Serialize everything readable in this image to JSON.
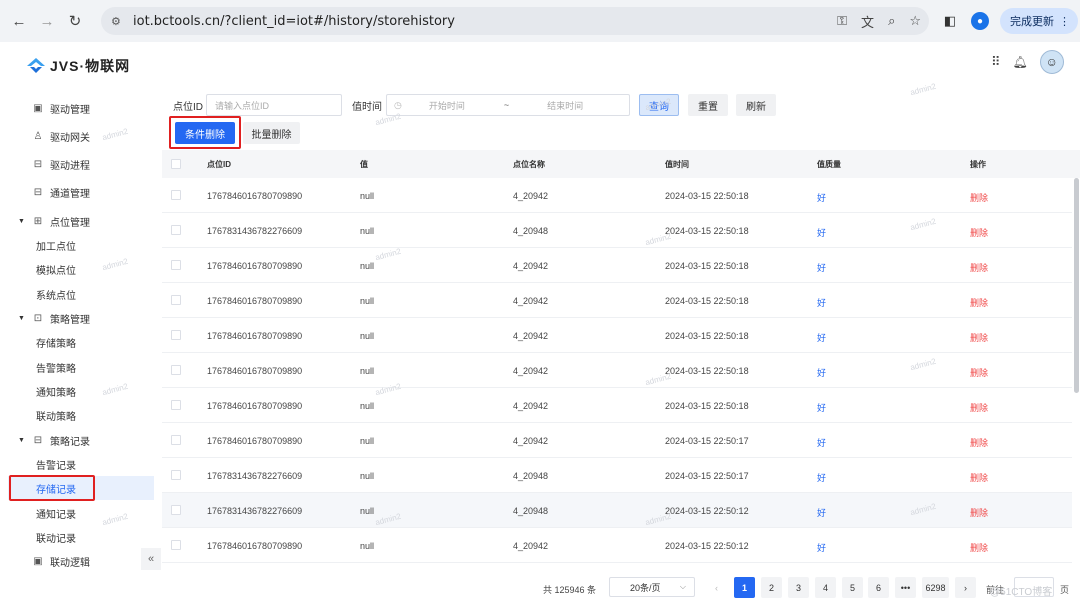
{
  "browser": {
    "url": "iot.bctools.cn/?client_id=iot#/history/storehistory",
    "update_label": "完成更新",
    "profile_initial": "●"
  },
  "app": {
    "logo_text": "JVS·物联网"
  },
  "sidebar": {
    "items": [
      {
        "label": "驱动管理",
        "icon": "▣"
      },
      {
        "label": "驱动网关",
        "icon": "♙"
      },
      {
        "label": "驱动进程",
        "icon": "⊟"
      },
      {
        "label": "通道管理",
        "icon": "⊟"
      },
      {
        "label": "点位管理",
        "icon": "⊞"
      },
      {
        "label": "策略管理",
        "icon": "⊡"
      },
      {
        "label": "策略记录",
        "icon": "⊟"
      },
      {
        "label": "联动逻辑",
        "icon": "▣"
      }
    ],
    "subitems": {
      "point": [
        "加工点位",
        "模拟点位",
        "系统点位"
      ],
      "strategy": [
        "存储策略",
        "告警策略",
        "通知策略",
        "联动策略"
      ],
      "records": [
        "告警记录",
        "存储记录",
        "通知记录",
        "联动记录"
      ]
    },
    "collapse_glyph": "«"
  },
  "filters": {
    "point_id_label": "点位ID",
    "point_id_placeholder": "请输入点位ID",
    "value_time_label": "值时间",
    "start_placeholder": "开始时间",
    "range_sep": "~",
    "end_placeholder": "结束时间",
    "query_label": "查询",
    "reset_label": "重置",
    "refresh_label": "刷新",
    "conditional_delete_label": "条件删除",
    "batch_delete_label": "批量删除"
  },
  "table": {
    "columns": [
      "点位ID",
      "值",
      "点位名称",
      "值时间",
      "值质量",
      "操作"
    ],
    "rows": [
      {
        "id": "1767846016780709890",
        "value": "null",
        "name": "4_20942",
        "time": "2024-03-15 22:50:18",
        "quality": "好",
        "action": "删除"
      },
      {
        "id": "1767831436782276609",
        "value": "null",
        "name": "4_20948",
        "time": "2024-03-15 22:50:18",
        "quality": "好",
        "action": "删除"
      },
      {
        "id": "1767846016780709890",
        "value": "null",
        "name": "4_20942",
        "time": "2024-03-15 22:50:18",
        "quality": "好",
        "action": "删除"
      },
      {
        "id": "1767846016780709890",
        "value": "null",
        "name": "4_20942",
        "time": "2024-03-15 22:50:18",
        "quality": "好",
        "action": "删除"
      },
      {
        "id": "1767846016780709890",
        "value": "null",
        "name": "4_20942",
        "time": "2024-03-15 22:50:18",
        "quality": "好",
        "action": "删除"
      },
      {
        "id": "1767846016780709890",
        "value": "null",
        "name": "4_20942",
        "time": "2024-03-15 22:50:18",
        "quality": "好",
        "action": "删除"
      },
      {
        "id": "1767846016780709890",
        "value": "null",
        "name": "4_20942",
        "time": "2024-03-15 22:50:18",
        "quality": "好",
        "action": "删除"
      },
      {
        "id": "1767846016780709890",
        "value": "null",
        "name": "4_20942",
        "time": "2024-03-15 22:50:17",
        "quality": "好",
        "action": "删除"
      },
      {
        "id": "1767831436782276609",
        "value": "null",
        "name": "4_20948",
        "time": "2024-03-15 22:50:17",
        "quality": "好",
        "action": "删除"
      },
      {
        "id": "1767831436782276609",
        "value": "null",
        "name": "4_20948",
        "time": "2024-03-15 22:50:12",
        "quality": "好",
        "action": "删除"
      },
      {
        "id": "1767846016780709890",
        "value": "null",
        "name": "4_20942",
        "time": "2024-03-15 22:50:12",
        "quality": "好",
        "action": "删除"
      }
    ]
  },
  "pagination": {
    "total_text": "共 125946 条",
    "page_size": "20条/页",
    "pages": [
      "1",
      "2",
      "3",
      "4",
      "5",
      "6",
      "•••",
      "6298"
    ],
    "prev": "‹",
    "next": "›",
    "goto_label": "前往",
    "page_suffix": "页"
  },
  "watermark_text": "admin2",
  "credit_text": "@51CTO博客",
  "colors": {
    "primary": "#2468f2",
    "danger": "#f04848",
    "highlight_box": "#e02020"
  }
}
